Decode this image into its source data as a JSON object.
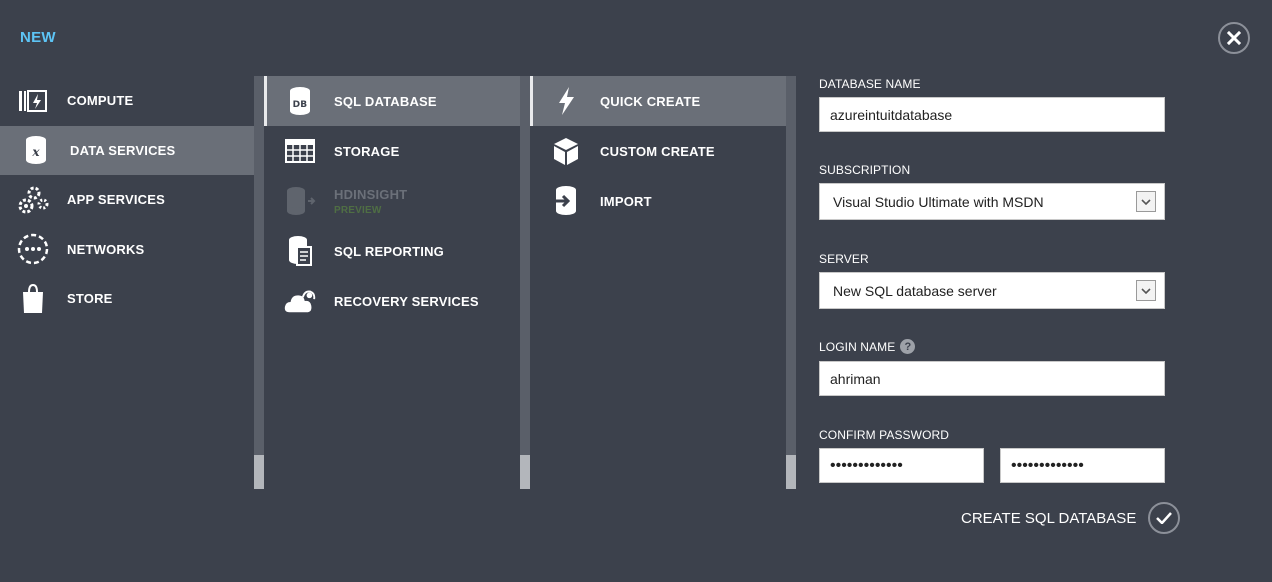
{
  "header": {
    "title": "NEW"
  },
  "categories": [
    {
      "label": "COMPUTE",
      "icon": "compute-icon"
    },
    {
      "label": "DATA SERVICES",
      "icon": "data-services-icon",
      "selected": true
    },
    {
      "label": "APP SERVICES",
      "icon": "app-services-icon"
    },
    {
      "label": "NETWORKS",
      "icon": "networks-icon"
    },
    {
      "label": "STORE",
      "icon": "store-icon"
    }
  ],
  "services": [
    {
      "label": "SQL DATABASE",
      "icon": "sql-database-icon",
      "icon_text": "DB",
      "selected": true
    },
    {
      "label": "STORAGE",
      "icon": "storage-icon"
    },
    {
      "label": "HDINSIGHT",
      "sublabel": "PREVIEW",
      "icon": "hdinsight-icon",
      "disabled": true
    },
    {
      "label": "SQL REPORTING",
      "icon": "sql-reporting-icon"
    },
    {
      "label": "RECOVERY SERVICES",
      "icon": "recovery-services-icon"
    }
  ],
  "actions": [
    {
      "label": "QUICK CREATE",
      "icon": "lightning-icon",
      "selected": true
    },
    {
      "label": "CUSTOM CREATE",
      "icon": "box-icon"
    },
    {
      "label": "IMPORT",
      "icon": "import-icon"
    }
  ],
  "form": {
    "database_name": {
      "label": "DATABASE NAME",
      "value": "azureintuitdatabase"
    },
    "subscription": {
      "label": "SUBSCRIPTION",
      "value": "Visual Studio Ultimate with MSDN"
    },
    "server": {
      "label": "SERVER",
      "value": "New SQL database server"
    },
    "login_name": {
      "label": "LOGIN NAME",
      "value": "ahriman",
      "help": "?"
    },
    "password": {
      "label": "CONFIRM PASSWORD",
      "value": "•••••••••••••",
      "confirm_value": "•••••••••••••"
    }
  },
  "submit": {
    "label": "CREATE SQL DATABASE"
  },
  "colors": {
    "accent": "#5dc4f5",
    "background": "#3c414c",
    "selected": "#6a6f78"
  }
}
